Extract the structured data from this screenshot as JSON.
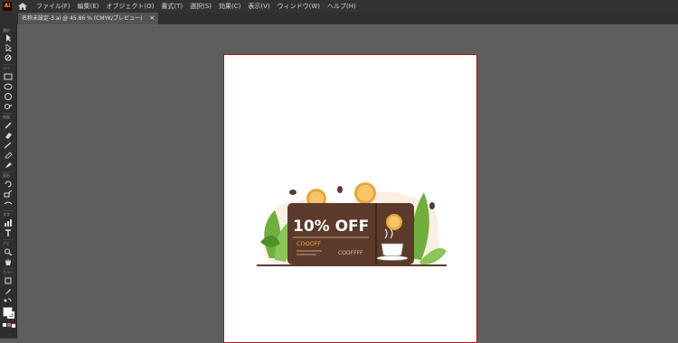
{
  "app": {
    "logo_text": "Ai"
  },
  "menubar": {
    "items": [
      "ファイル(F)",
      "編集(E)",
      "オブジェクト(O)",
      "書式(T)",
      "選択(S)",
      "効果(C)",
      "表示(V)",
      "ウィンドウ(W)",
      "ヘルプ(H)"
    ]
  },
  "tab": {
    "title": "名称未設定-3.ai @ 45.86 % (CMYK/プレビュー)",
    "close": "×"
  },
  "toolbar": {
    "labels": [
      "選択",
      "ライ",
      "描画",
      "変形",
      "文字",
      "ナビ",
      "カラー"
    ]
  },
  "artwork": {
    "headline": "10% OFF",
    "code": "COOOFF",
    "subcode": "COOFFFF",
    "colors": {
      "coupon": "#5b3a2b",
      "accent": "#e8a53a",
      "leaf": "#6fae3f",
      "background_blob": "#fbeee3"
    }
  }
}
